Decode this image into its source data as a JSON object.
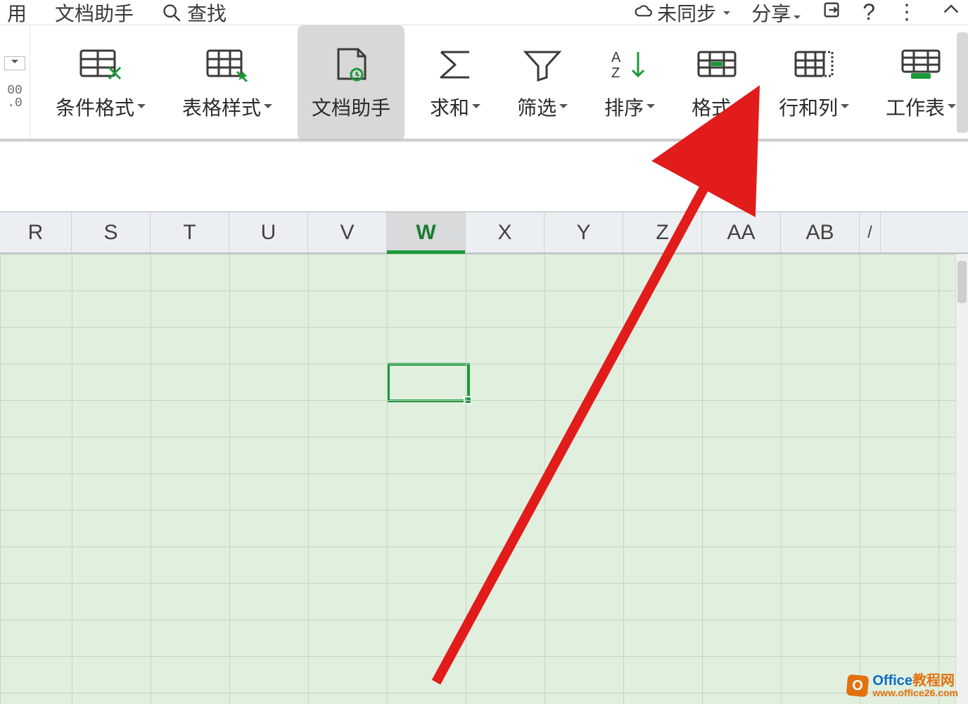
{
  "top": {
    "yong": "用",
    "doc_helper": "文档助手",
    "find": "查找",
    "unsynced": "未同步",
    "share": "分享"
  },
  "ribbon": {
    "side_label": "00\n.0",
    "cond_format": "条件格式",
    "table_style": "表格样式",
    "doc_helper": "文档助手",
    "sum": "求和",
    "filter": "筛选",
    "sort": "排序",
    "format": "格式",
    "rows_cols": "行和列",
    "worksheet": "工作表"
  },
  "columns": [
    "R",
    "S",
    "T",
    "U",
    "V",
    "W",
    "X",
    "Y",
    "Z",
    "AA",
    "AB"
  ],
  "active_col": "W",
  "watermark": {
    "title_blue": "Office",
    "title_orange": "教程网",
    "url": "www.office26.com",
    "logo_letter": "O"
  }
}
